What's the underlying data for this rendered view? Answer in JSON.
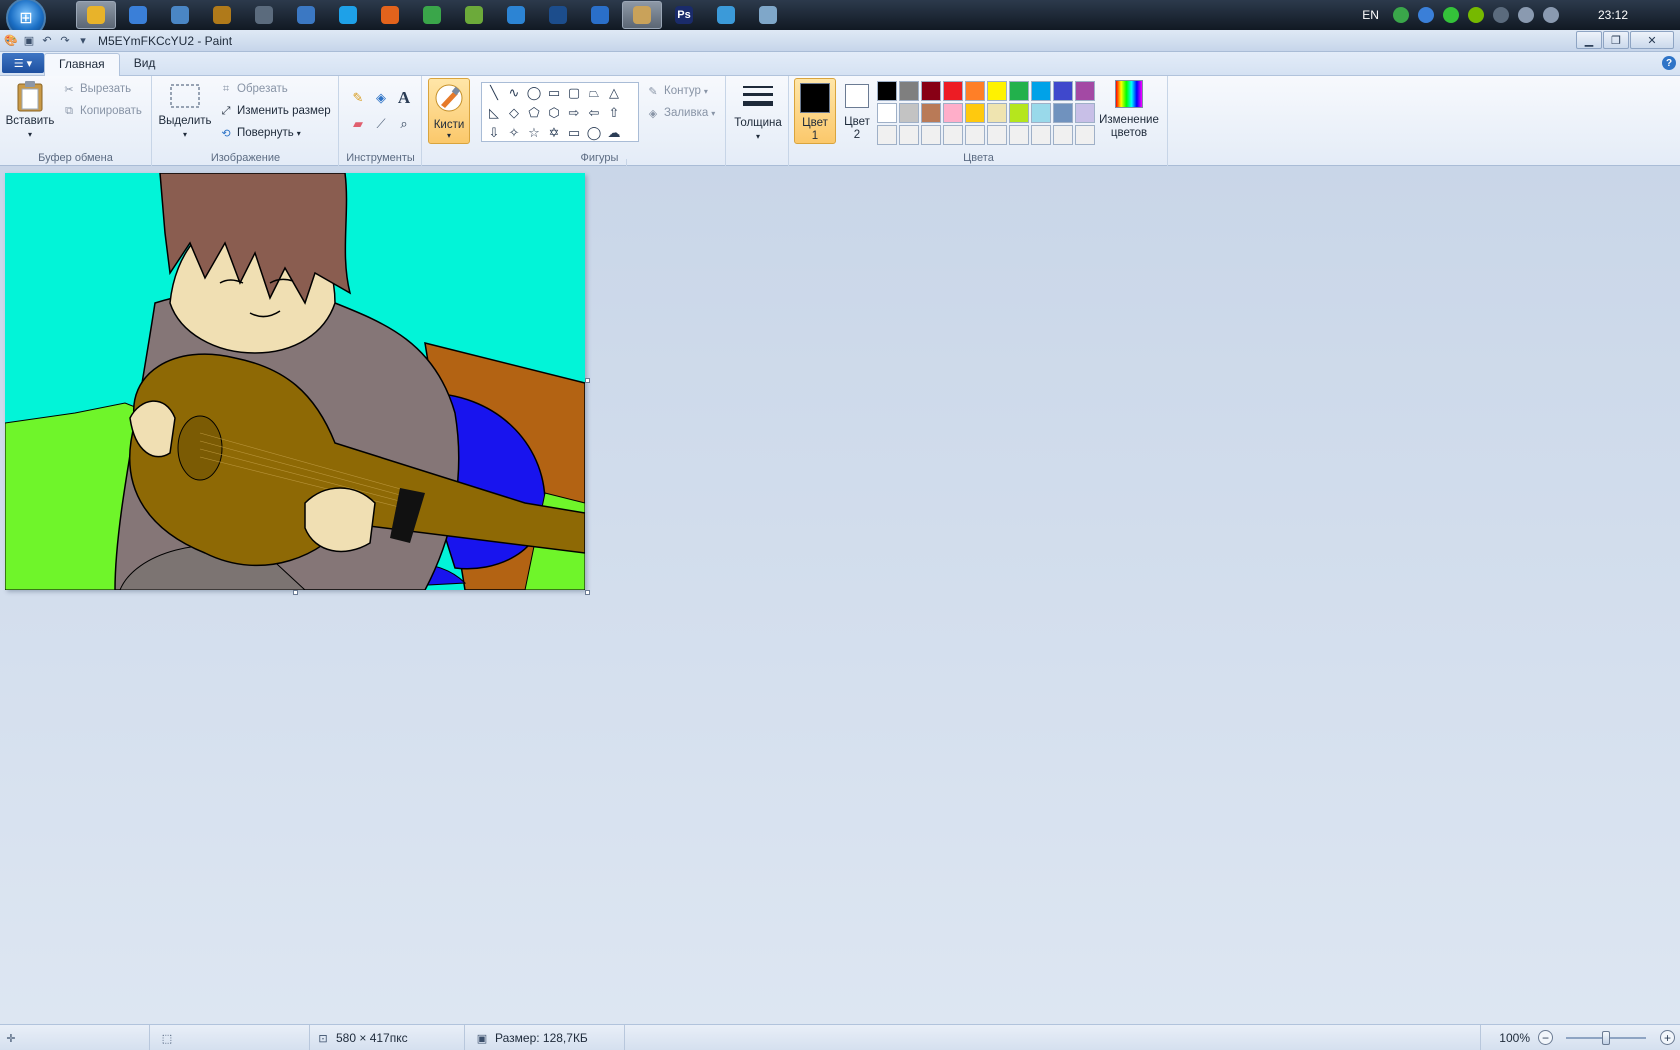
{
  "taskbar": {
    "apps": [
      {
        "name": "chrome-icon",
        "color": "#e8b32a",
        "active": true
      },
      {
        "name": "itunes-icon",
        "color": "#3a7fd8"
      },
      {
        "name": "globe-icon",
        "color": "#4a86c5"
      },
      {
        "name": "warcraft-icon",
        "color": "#b07a1a"
      },
      {
        "name": "steam-icon",
        "color": "#5b6b7d"
      },
      {
        "name": "cleaner-icon",
        "color": "#3b78c3"
      },
      {
        "name": "skype-icon",
        "color": "#1ea1e8"
      },
      {
        "name": "origin-icon",
        "color": "#e2631c"
      },
      {
        "name": "utorrent-icon",
        "color": "#3aa64a"
      },
      {
        "name": "photo-icon",
        "color": "#6caa3a"
      },
      {
        "name": "feather-icon",
        "color": "#2c84d4"
      },
      {
        "name": "media-icon",
        "color": "#1c4d8c"
      },
      {
        "name": "earth-icon",
        "color": "#2a6fc9"
      },
      {
        "name": "paint-icon",
        "color": "#c9a25a",
        "active": true
      },
      {
        "name": "photoshop-icon",
        "color": "#1a2b6b",
        "label": "Ps"
      },
      {
        "name": "notes-icon",
        "color": "#3b9ad9"
      },
      {
        "name": "notepad-icon",
        "color": "#7fa7c9"
      }
    ],
    "tray": {
      "lang": "EN",
      "clock": "23:12",
      "icons": [
        {
          "name": "utorrent-tray-icon",
          "color": "#3aa64a"
        },
        {
          "name": "shield-tray-icon",
          "color": "#3a7fd8"
        },
        {
          "name": "razer-tray-icon",
          "color": "#34c23a"
        },
        {
          "name": "nvidia-tray-icon",
          "color": "#76b900"
        },
        {
          "name": "steam-tray-icon",
          "color": "#5b6b7d"
        },
        {
          "name": "volume-tray-icon",
          "color": "#8a9ab0"
        },
        {
          "name": "network-tray-icon",
          "color": "#8a9ab0"
        }
      ]
    }
  },
  "window": {
    "title": "M5EYmFKCcYU2 - Paint"
  },
  "tabs": {
    "home": "Главная",
    "view": "Вид"
  },
  "ribbon": {
    "clipboard": {
      "label": "Буфер обмена",
      "paste": "Вставить",
      "cut": "Вырезать",
      "copy": "Копировать"
    },
    "image": {
      "label": "Изображение",
      "select": "Выделить",
      "crop": "Обрезать",
      "resize": "Изменить размер",
      "rotate": "Повернуть"
    },
    "tools": {
      "label": "Инструменты"
    },
    "brushes": "Кисти",
    "shapes": {
      "label": "Фигуры",
      "outline": "Контур",
      "fill": "Заливка"
    },
    "size": "Толщина",
    "colors": {
      "label": "Цвета",
      "color1_line1": "Цвет",
      "color1_line2": "1",
      "color2_line1": "Цвет",
      "color2_line2": "2",
      "edit_line1": "Изменение",
      "edit_line2": "цветов",
      "color1": "#000000",
      "color2": "#ffffff",
      "palette": [
        "#000000",
        "#7f7f7f",
        "#880015",
        "#ed1c24",
        "#ff7f27",
        "#fff200",
        "#22b14c",
        "#00a2e8",
        "#3f48cc",
        "#a349a4",
        "#ffffff",
        "#c3c3c3",
        "#b97a57",
        "#ffaec9",
        "#ffc90e",
        "#efe4b0",
        "#b5e61d",
        "#99d9ea",
        "#7092be",
        "#c8bfe7",
        "#f0f0f0",
        "#f0f0f0",
        "#f0f0f0",
        "#f0f0f0",
        "#f0f0f0",
        "#f0f0f0",
        "#f0f0f0",
        "#f0f0f0",
        "#f0f0f0",
        "#f0f0f0"
      ]
    }
  },
  "statusbar": {
    "dimensions": "580 × 417пкс",
    "size": "Размер: 128,7КБ",
    "zoom": "100%",
    "zoom_fraction": 0.5
  }
}
